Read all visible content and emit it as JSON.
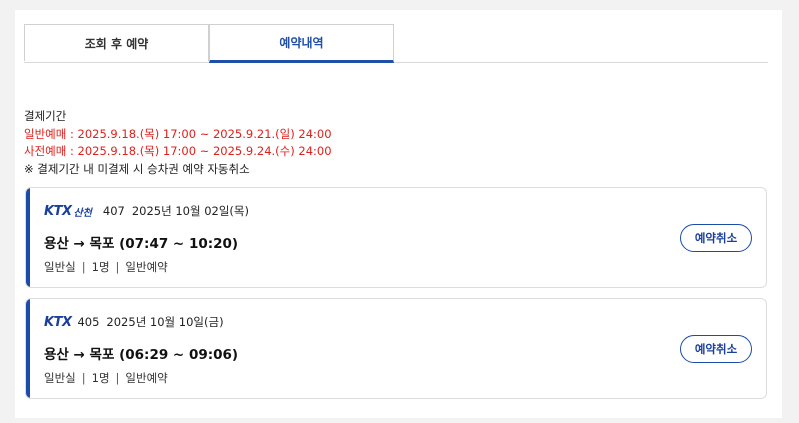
{
  "tabs": [
    {
      "label": "조회 후 예약"
    },
    {
      "label": "예약내역"
    }
  ],
  "notice": {
    "title": "결제기간",
    "general": "일반예매 : 2025.9.18.(목) 17:00 ~ 2025.9.21.(일) 24:00",
    "advance": "사전예매 : 2025.9.18.(목) 17:00 ~ 2025.9.24.(수) 24:00",
    "note": "※ 결제기간 내 미결제 시 승차권 예약 자동취소"
  },
  "reservations": [
    {
      "brand": "KTX",
      "brand_sub": "산천",
      "train_no": "407",
      "date": "2025년 10월 02일(목)",
      "route": "용산 → 목포 (07:47 ~ 10:20)",
      "seat_class": "일반실",
      "count": "1명",
      "type": "일반예약",
      "cancel_label": "예약취소"
    },
    {
      "brand": "KTX",
      "brand_sub": "",
      "train_no": "405",
      "date": "2025년 10월 10일(금)",
      "route": "용산 → 목포 (06:29 ~ 09:06)",
      "seat_class": "일반실",
      "count": "1명",
      "type": "일반예약",
      "cancel_label": "예약취소"
    }
  ],
  "colors": {
    "accent": "#1a4ca8",
    "notice_red": "#e0201c"
  }
}
